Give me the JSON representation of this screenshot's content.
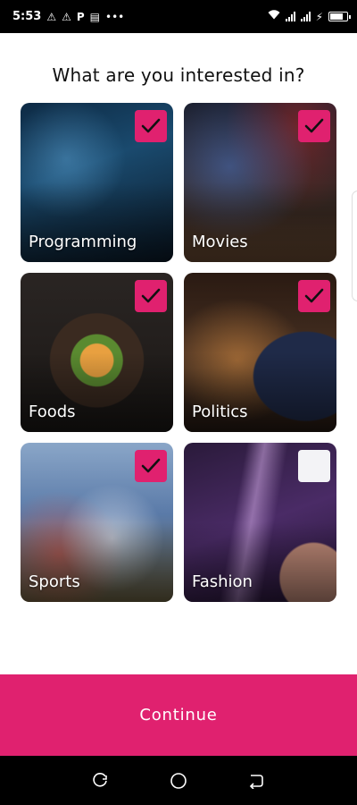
{
  "status_bar": {
    "time": "5:53",
    "left_icons": [
      "warning-icon",
      "warning-icon",
      "parking-icon",
      "news-icon",
      "more-dots-icon"
    ],
    "right_icons": [
      "wifi-icon",
      "signal-icon",
      "signal-icon",
      "charging-icon",
      "battery-icon"
    ]
  },
  "screen": {
    "title": "What are you interested in?"
  },
  "interests": [
    {
      "label": "Programming",
      "selected": true
    },
    {
      "label": "Movies",
      "selected": true
    },
    {
      "label": "Foods",
      "selected": true
    },
    {
      "label": "Politics",
      "selected": true
    },
    {
      "label": "Sports",
      "selected": true
    },
    {
      "label": "Fashion",
      "selected": false
    }
  ],
  "actions": {
    "continue_label": "Continue"
  },
  "nav_bar": {
    "buttons": [
      "recents-icon",
      "home-icon",
      "back-icon"
    ]
  },
  "colors": {
    "accent": "#e0216f",
    "unchecked": "#f3f3f6"
  }
}
